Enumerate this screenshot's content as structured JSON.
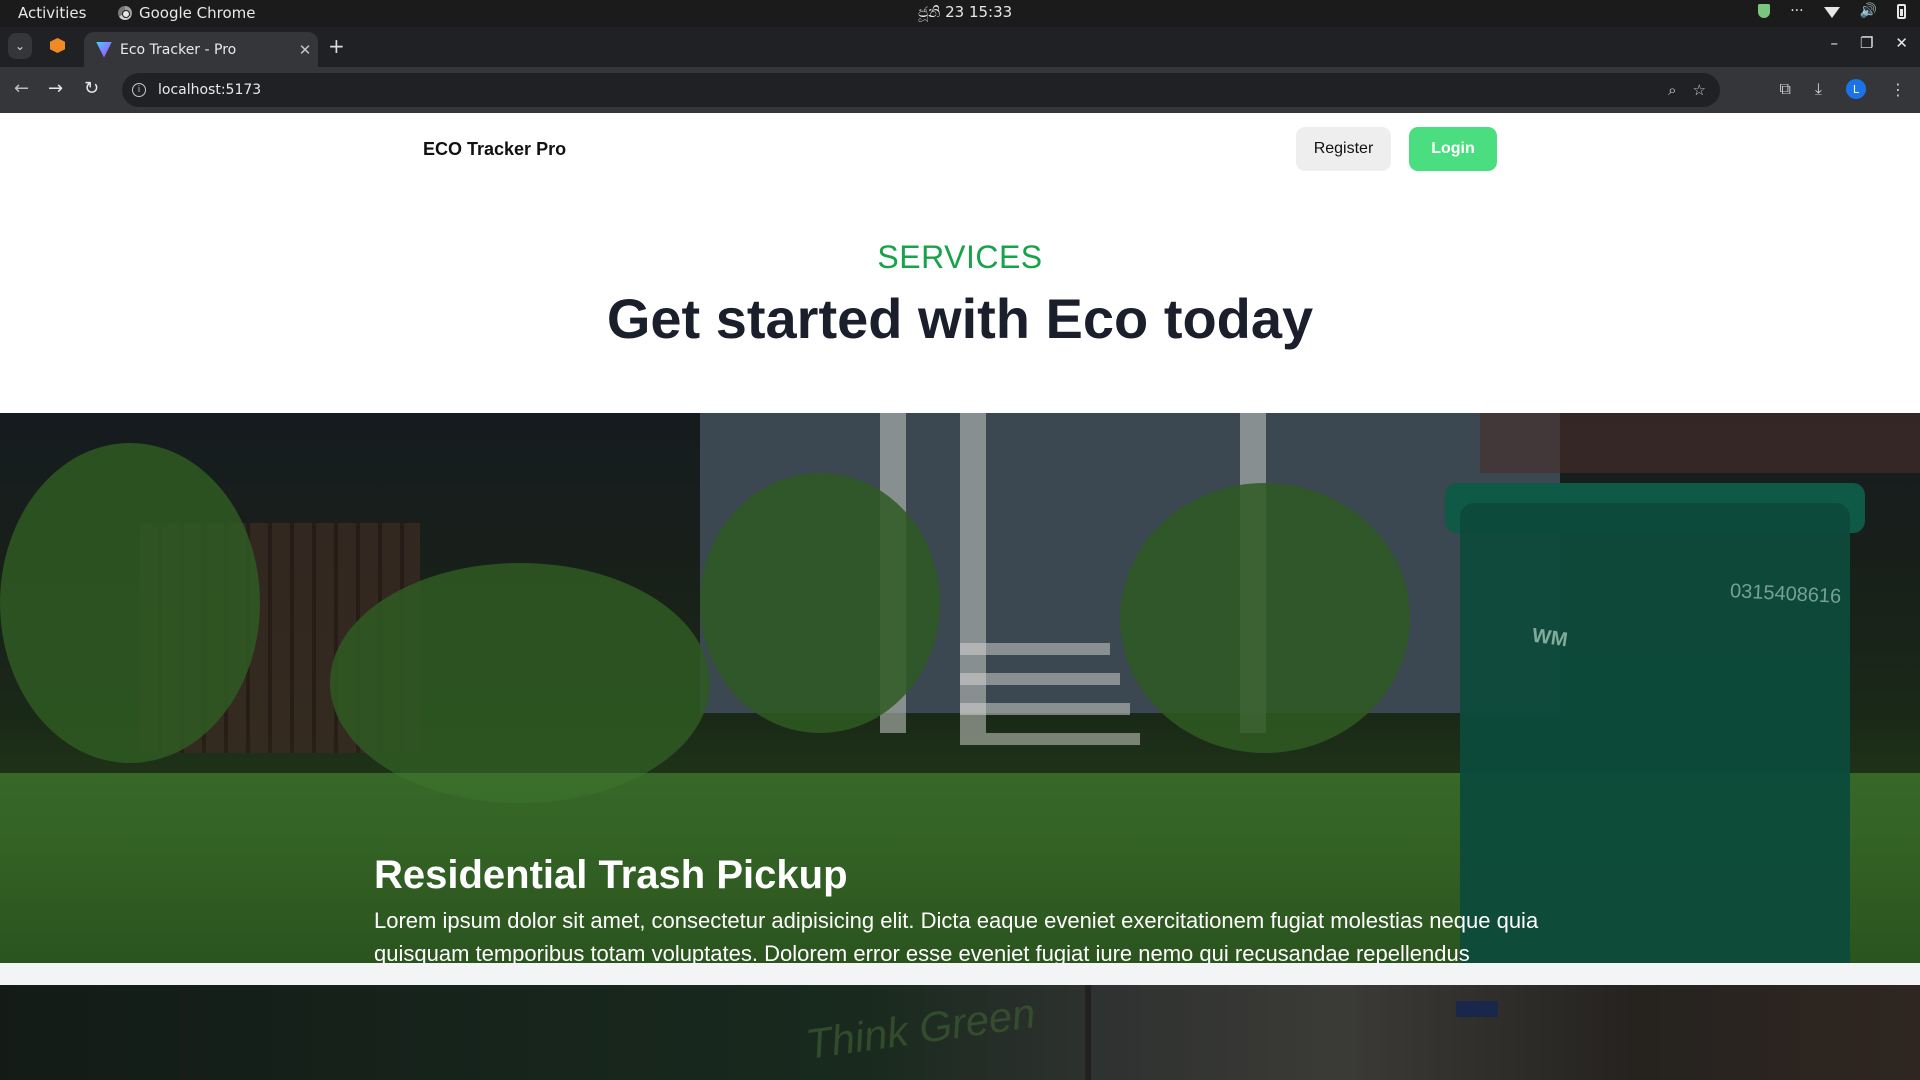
{
  "os": {
    "activities": "Activities",
    "app_name": "Google Chrome",
    "clock": "ජූනි 23  15:33",
    "tray_dots": "···"
  },
  "browser": {
    "tab_title": "Eco Tracker - Pro",
    "tab_close": "✕",
    "new_tab": "+",
    "url": "localhost:5173",
    "window_minimize": "–",
    "window_restore": "❐",
    "window_close": "✕"
  },
  "site": {
    "brand": "ECO Tracker Pro",
    "register_label": "Register",
    "login_label": "Login",
    "services_label": "SERVICES",
    "services_heading": "Get started with Eco today",
    "service_card": {
      "title": "Residential Trash Pickup",
      "description": "Lorem ipsum dolor sit amet, consectetur adipisicing elit. Dicta eaque eveniet exercitationem fugiat molestias neque quia quisquam temporibus totam voluptates. Dolorem error esse eveniet fugiat iure nemo qui recusandae repellendus",
      "bin_number": "0315408616",
      "bin_logo": "WM"
    },
    "service_card_2": {
      "truck_text": "Think Green"
    }
  },
  "colors": {
    "accent_green": "#16a34a",
    "login_button": "#4ade80",
    "heading": "#1a1f2b"
  }
}
